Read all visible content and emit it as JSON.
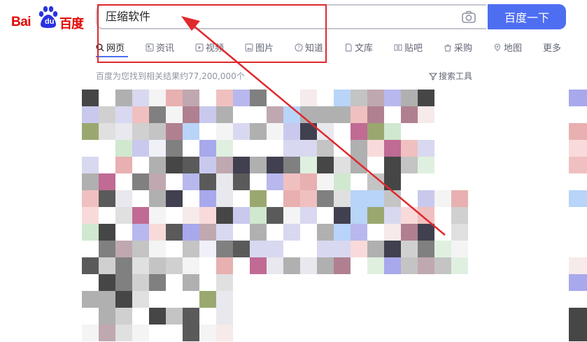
{
  "logo": {
    "latin": "Bai",
    "du": "du",
    "chinese": "百度"
  },
  "search": {
    "value": "压缩软件",
    "button_label": "百度一下"
  },
  "tabs": [
    {
      "label": "网页",
      "icon": "search-icon",
      "active": true
    },
    {
      "label": "资讯",
      "icon": "news-icon",
      "active": false
    },
    {
      "label": "视频",
      "icon": "video-icon",
      "active": false
    },
    {
      "label": "图片",
      "icon": "image-icon",
      "active": false
    },
    {
      "label": "知道",
      "icon": "question-icon",
      "active": false
    },
    {
      "label": "文库",
      "icon": "document-icon",
      "active": false
    },
    {
      "label": "贴吧",
      "icon": "tieba-icon",
      "active": false
    },
    {
      "label": "采购",
      "icon": "shopping-icon",
      "active": false
    },
    {
      "label": "地图",
      "icon": "map-icon",
      "active": false
    },
    {
      "label": "更多",
      "icon": "",
      "active": false
    }
  ],
  "results": {
    "count_text": "百度为您找到相关结果约77,200,000个",
    "tools_label": "搜索工具"
  },
  "colors": {
    "brand_red": "#e10601",
    "brand_blue": "#4e6ef2",
    "annotation_red": "#e0282e"
  }
}
